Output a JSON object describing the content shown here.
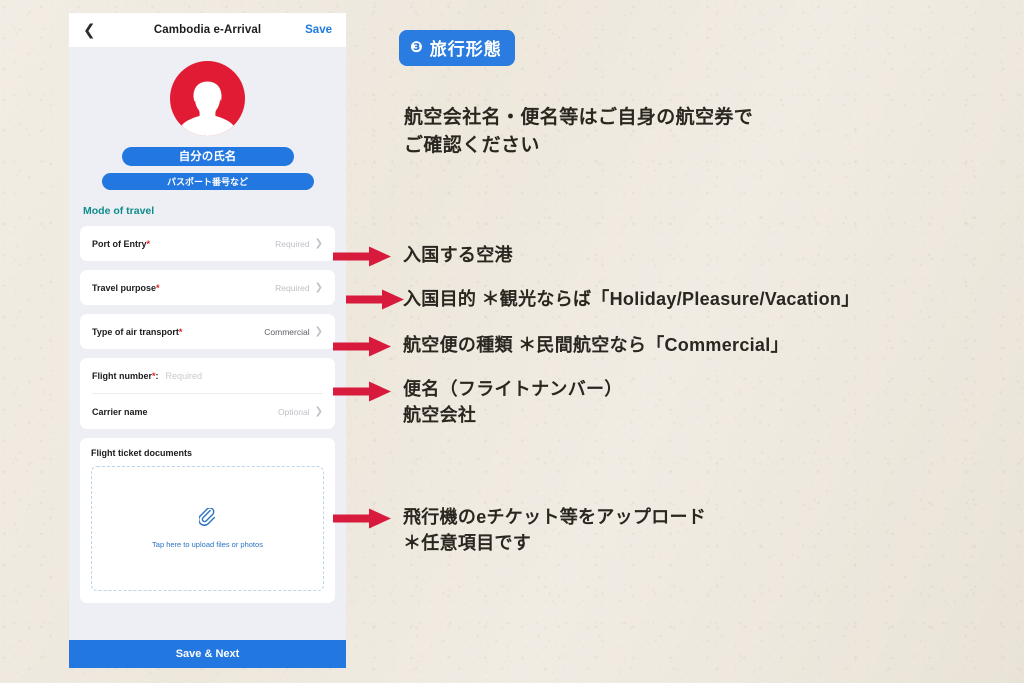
{
  "background": {
    "color": "#EFEAE0"
  },
  "phone": {
    "nav": {
      "back_icon": "chevron-left-icon",
      "title": "Cambodia e-Arrival",
      "save_label": "Save"
    },
    "profile": {
      "avatar_icon": "person-avatar-icon",
      "name_button": "自分の氏名",
      "passport_button": "パスポート番号など"
    },
    "section_title": "Mode of travel",
    "rows": [
      {
        "label": "Port of Entry",
        "required_mark": "*",
        "value": "Required",
        "filled": false,
        "chevron": "chevron-right-icon"
      },
      {
        "label": "Travel purpose",
        "required_mark": "*",
        "value": "Required",
        "filled": false,
        "chevron": "chevron-right-icon"
      },
      {
        "label": "Type of air transport",
        "required_mark": "*",
        "value": "Commercial",
        "filled": true,
        "chevron": "chevron-right-icon"
      },
      {
        "label": "Flight number",
        "required_mark": "*",
        "suffix": ":",
        "placeholder": "Required"
      },
      {
        "label": "Carrier name",
        "required_mark": "",
        "value": "Optional",
        "filled": false,
        "chevron": "chevron-right-icon"
      }
    ],
    "upload": {
      "title": "Flight ticket documents",
      "icon": "paperclip-icon",
      "hint": "Tap here to upload files or photos"
    },
    "primary_button": "Save & Next"
  },
  "annotations": {
    "badge": {
      "number": "❸",
      "label": "旅行形態",
      "color": "#2B7CE0"
    },
    "intro_line1": "航空会社名・便名等はご自身の航空券で",
    "intro_line2": "ご確認ください",
    "arrow_color": "#D81B3C",
    "callouts": [
      {
        "id": "port-of-entry",
        "text": "入国する空港"
      },
      {
        "id": "travel-purpose",
        "text": "入国目的 ＊観光ならば「Holiday/Pleasure/Vacation」"
      },
      {
        "id": "air-transport-type",
        "text": "航空便の種類 ＊民間航空なら「Commercial」"
      },
      {
        "id": "flight-number-line1",
        "text": "便名（フライトナンバー）"
      },
      {
        "id": "flight-number-line2",
        "text": "航空会社"
      },
      {
        "id": "upload-line1",
        "text": "飛行機のeチケット等をアップロード"
      },
      {
        "id": "upload-line2",
        "text": "＊任意項目です"
      }
    ]
  }
}
